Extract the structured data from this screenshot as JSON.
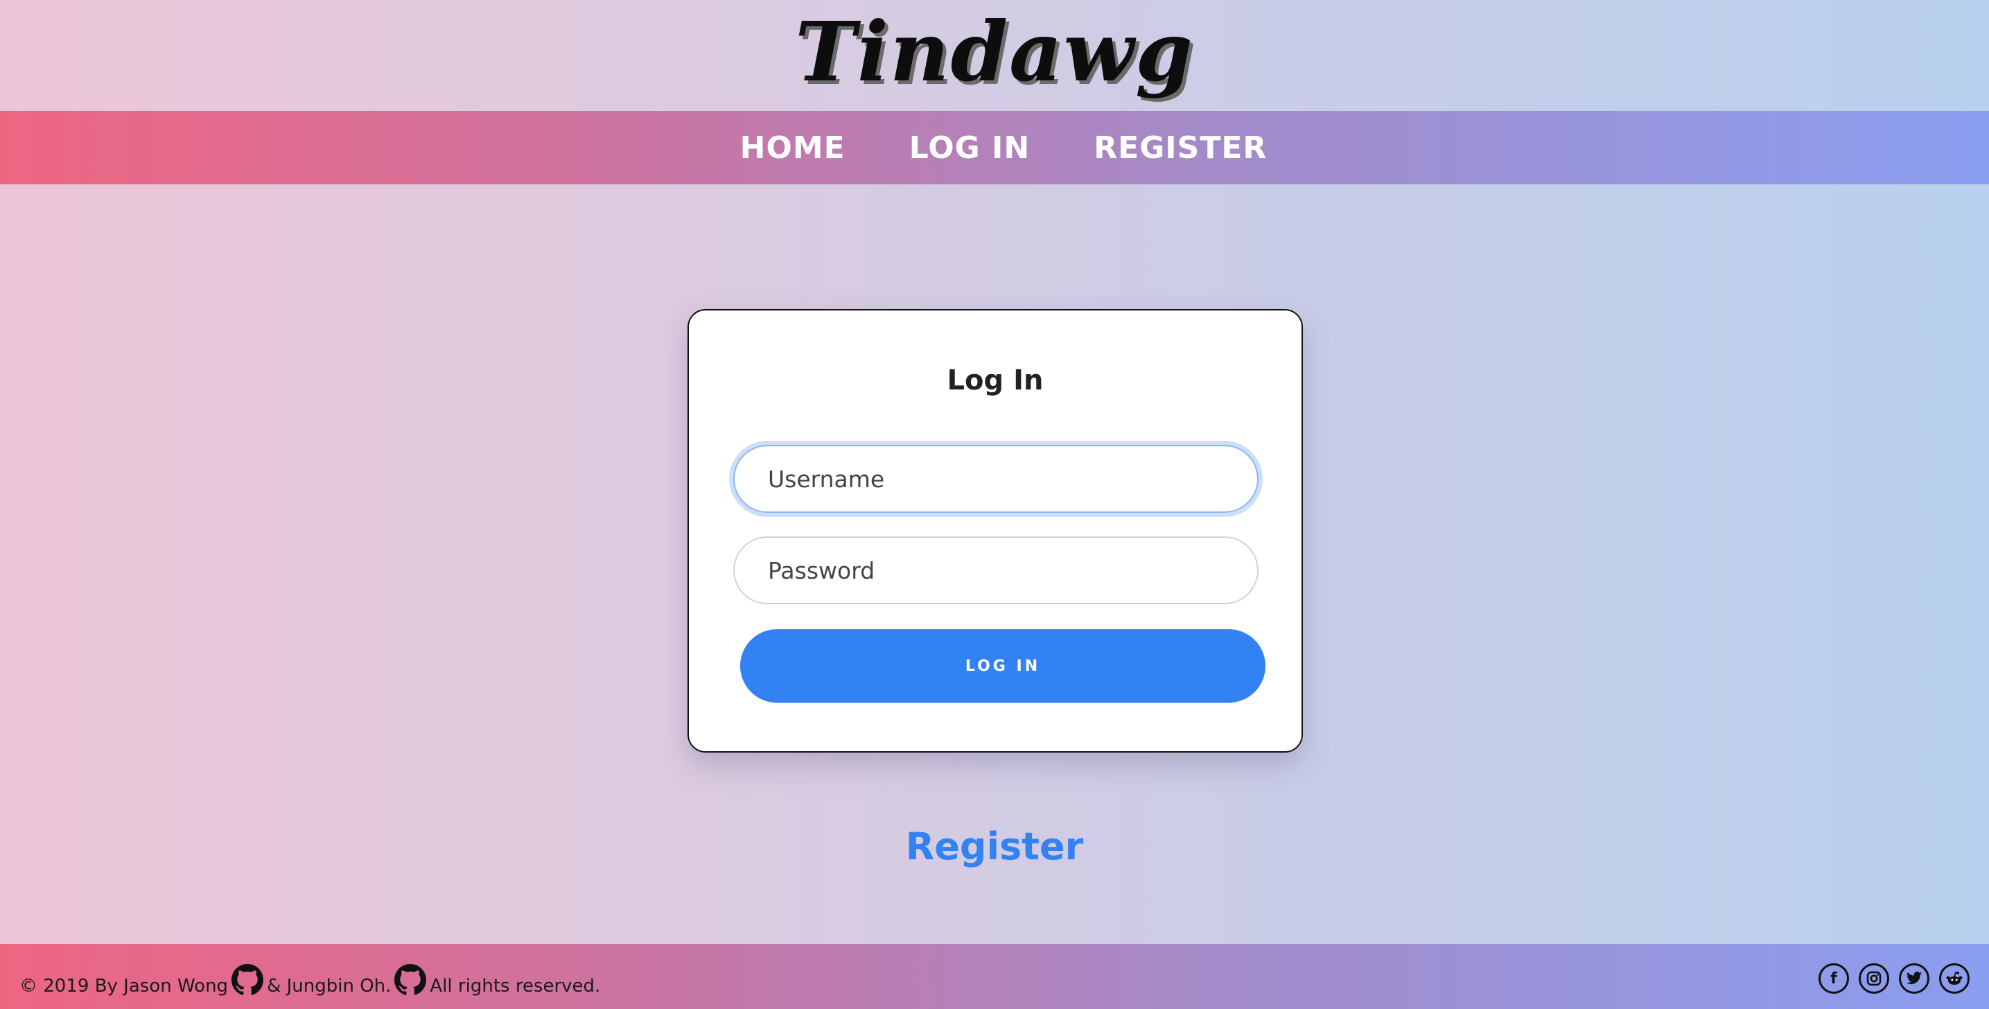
{
  "brand": {
    "logo_text": "Tindawg"
  },
  "nav": {
    "items": [
      {
        "label": "HOME"
      },
      {
        "label": "LOG IN"
      },
      {
        "label": "REGISTER"
      }
    ]
  },
  "login": {
    "title": "Log In",
    "username_placeholder": "Username",
    "username_value": "",
    "password_placeholder": "Password",
    "password_value": "",
    "submit_label": "LOG IN"
  },
  "register_link": "Register",
  "footer": {
    "copyright_prefix": "© 2019 By Jason Wong",
    "and_text": "& Jungbin Oh.",
    "suffix": "All rights reserved.",
    "icons": [
      "github-icon",
      "github-icon"
    ],
    "social_icons": [
      "facebook-icon",
      "instagram-icon",
      "twitter-icon",
      "reddit-icon"
    ]
  },
  "colors": {
    "accent_blue": "#3382f4",
    "nav_gradient_start": "#ee6582",
    "nav_gradient_end": "#8a9ef0"
  }
}
